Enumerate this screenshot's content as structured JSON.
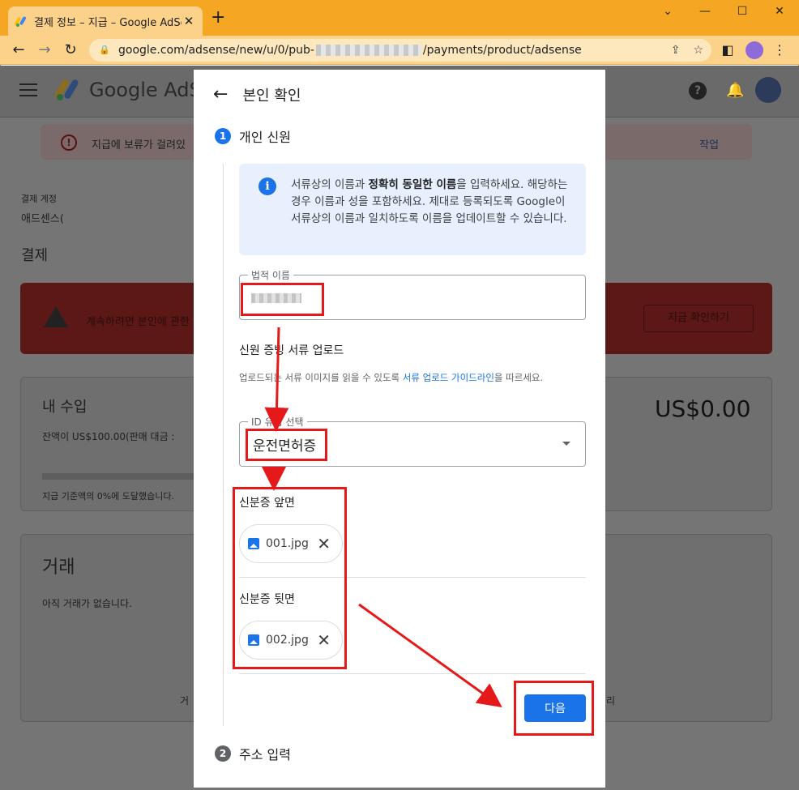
{
  "browser": {
    "tab_title": "결제 정보 – 지급 – Google AdSe",
    "url_prefix": "google.com/adsense/new/u/0/pub-",
    "url_suffix": "/payments/product/adsense"
  },
  "background": {
    "app_name": "Google AdS",
    "alert_text": "지급에 보류가 걸려있",
    "alert_action": "작업",
    "account_label": "결제 계정",
    "account_value": "애드센스(",
    "section_title": "결제",
    "warning_text": "계속하려면 본인에 관한",
    "warning_button": "지금 확인하기",
    "earnings_title": "내 수입",
    "earnings_amount": "US$0.00",
    "earnings_note": "잔액이 US$100.00(판매 대금 :",
    "threshold_note": "지급 기준액의 0%에 도달했습니다.",
    "transactions_title": "거래",
    "transactions_empty": "아직 거래가 없습니다.",
    "footer_left": "거",
    "footer_right": "리"
  },
  "modal": {
    "title": "본인 확인",
    "step1_number": "1",
    "step1_label": "개인 신원",
    "info_plain1": "서류상의 이름과 ",
    "info_bold": "정확히 동일한 이름",
    "info_plain2": "을 입력하세요. 해당하는 경우 이름과 성을 포함하세요. 제대로 등록되도록 Google이 서류상의 이름과 일치하도록 이름을 업데이트할 수 있습니다.",
    "legal_name_label": "법적 이름",
    "upload_title": "신원 증빙 서류 업로드",
    "upload_desc_plain": "업로드되는 서류 이미지를 읽을 수 있도록 ",
    "upload_desc_link": "서류 업로드 가이드라인",
    "upload_desc_plain2": "을 따르세요.",
    "id_type_label": "ID 유형 선택",
    "id_type_value": "운전면허증",
    "front_label": "신분증 앞면",
    "front_file": "001.jpg",
    "back_label": "신분증 뒷면",
    "back_file": "002.jpg",
    "next_button": "다음",
    "step2_number": "2",
    "step2_label": "주소 입력"
  },
  "colors": {
    "accent": "#1a73e8",
    "annotation_red": "#e51919",
    "chrome_orange": "#f5a623"
  }
}
